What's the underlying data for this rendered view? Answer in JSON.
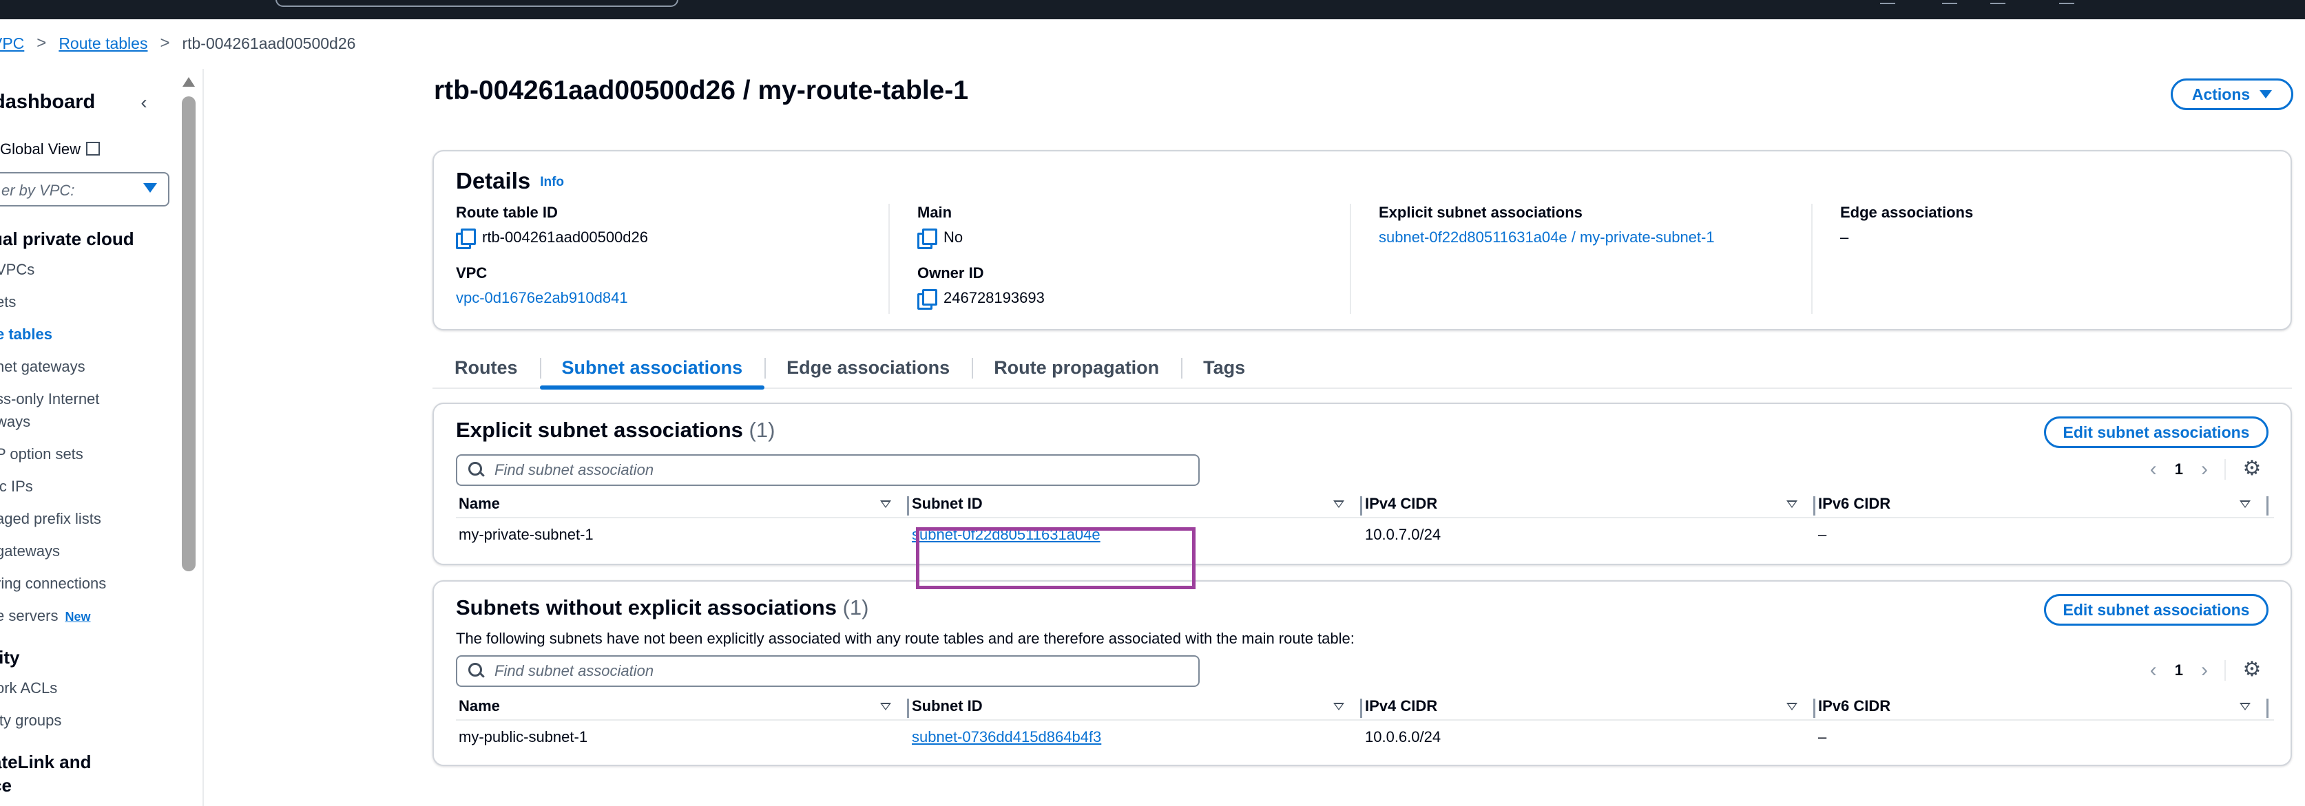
{
  "breadcrumb": {
    "vpc": "VPC",
    "route_tables": "Route tables",
    "current": "rtb-004261aad00500d26",
    "separator": ">"
  },
  "sidebar": {
    "title": "dashboard",
    "global_view": "Global View",
    "filter_placeholder": "er by VPC:",
    "sections": {
      "vpc": "ual private cloud",
      "security": "rity",
      "privatelink_1": "ateLink and",
      "privatelink_2": "ce"
    },
    "items": [
      {
        "label": "VPCs"
      },
      {
        "label": "ets"
      },
      {
        "label": "e tables",
        "active": true
      },
      {
        "label": "net gateways"
      },
      {
        "label": "ss-only Internet"
      },
      {
        "label": "ways"
      },
      {
        "label": "P option sets"
      },
      {
        "label": "ic IPs"
      },
      {
        "label": "aged prefix lists"
      },
      {
        "label": "gateways"
      },
      {
        "label": "ring connections"
      },
      {
        "label": "e servers"
      },
      {
        "label": "ork ACLs"
      },
      {
        "label": "ity groups"
      }
    ],
    "new_badge": "New"
  },
  "page": {
    "title": "rtb-004261aad00500d26 / my-route-table-1",
    "actions_label": "Actions"
  },
  "details": {
    "title": "Details",
    "info": "Info",
    "route_table_id_label": "Route table ID",
    "route_table_id": "rtb-004261aad00500d26",
    "vpc_label": "VPC",
    "vpc": "vpc-0d1676e2ab910d841",
    "main_label": "Main",
    "main": "No",
    "owner_label": "Owner ID",
    "owner": "246728193693",
    "explicit_label": "Explicit subnet associations",
    "explicit": "subnet-0f22d80511631a04e / my-private-subnet-1",
    "edge_label": "Edge associations",
    "edge": "–"
  },
  "tabs": [
    {
      "label": "Routes"
    },
    {
      "label": "Subnet associations",
      "active": true
    },
    {
      "label": "Edge associations"
    },
    {
      "label": "Route propagation"
    },
    {
      "label": "Tags"
    }
  ],
  "explicit_table": {
    "title": "Explicit subnet associations",
    "count": "(1)",
    "edit_label": "Edit subnet associations",
    "search_placeholder": "Find subnet association",
    "page": "1",
    "columns": [
      "Name",
      "Subnet ID",
      "IPv4 CIDR",
      "IPv6 CIDR"
    ],
    "rows": [
      {
        "name": "my-private-subnet-1",
        "subnet_id": "subnet-0f22d80511631a04e",
        "ipv4": "10.0.7.0/24",
        "ipv6": "–"
      }
    ]
  },
  "implicit_table": {
    "title": "Subnets without explicit associations",
    "count": "(1)",
    "description": "The following subnets have not been explicitly associated with any route tables and are therefore associated with the main route table:",
    "edit_label": "Edit subnet associations",
    "search_placeholder": "Find subnet association",
    "page": "1",
    "columns": [
      "Name",
      "Subnet ID",
      "IPv4 CIDR",
      "IPv6 CIDR"
    ],
    "rows": [
      {
        "name": "my-public-subnet-1",
        "subnet_id": "subnet-0736dd415d864b4f3",
        "ipv4": "10.0.6.0/24",
        "ipv6": "–"
      }
    ]
  },
  "icons": {
    "prev": "‹",
    "next": "›",
    "gear": "⚙",
    "collapse": "‹"
  }
}
